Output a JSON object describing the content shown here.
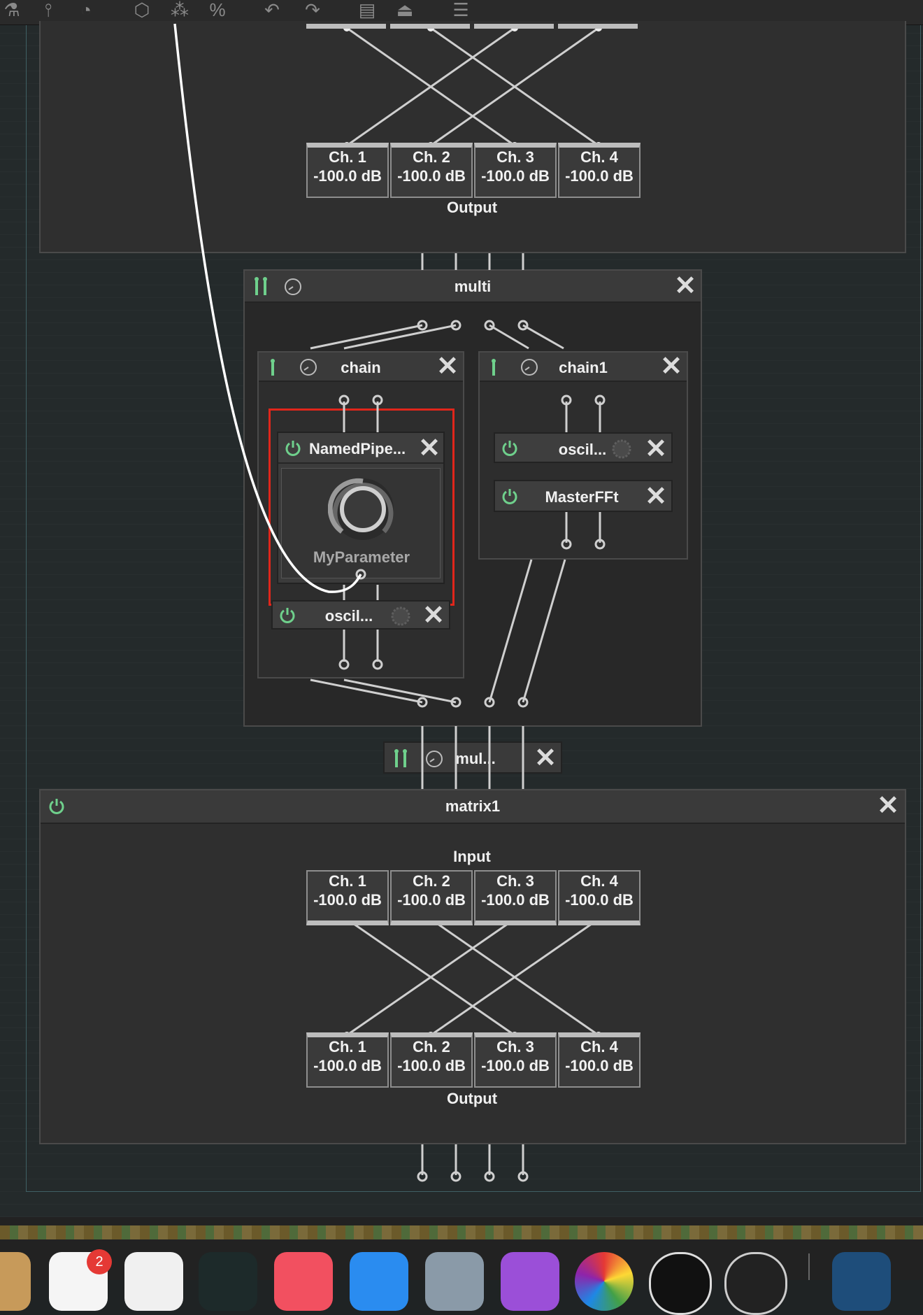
{
  "colors": {
    "accent_green": "#6fd08c",
    "highlight_red": "#e0261b",
    "cable_white": "#ffffff",
    "patch_grey": "#cfcfcf"
  },
  "toolbar": {
    "icons": [
      "flask-icon",
      "sliders-icon",
      "gauge-icon",
      "cube-icon",
      "circles-icon",
      "percent-icon",
      "undo-icon",
      "redo-icon",
      "save-icon",
      "eject-icon",
      "list-icon"
    ]
  },
  "top_matrix": {
    "outputs": [
      {
        "name": "Ch. 1",
        "level": "-100.0 dB"
      },
      {
        "name": "Ch. 2",
        "level": "-100.0 dB"
      },
      {
        "name": "Ch. 3",
        "level": "-100.0 dB"
      },
      {
        "name": "Ch. 4",
        "level": "-100.0 dB"
      }
    ],
    "output_label": "Output"
  },
  "multi": {
    "title": "multi",
    "chain": {
      "title": "chain",
      "named_pipe": {
        "title": "NamedPipe...",
        "knob_label": "MyParameter"
      },
      "oscil": {
        "title": "oscil..."
      }
    },
    "chain1": {
      "title": "chain1",
      "oscil": {
        "title": "oscil..."
      },
      "masterfft": {
        "title": "MasterFFt"
      }
    }
  },
  "mul_collapsed": {
    "title": "mul..."
  },
  "matrix1": {
    "title": "matrix1",
    "input_label": "Input",
    "inputs": [
      {
        "name": "Ch. 1",
        "level": "-100.0 dB"
      },
      {
        "name": "Ch. 2",
        "level": "-100.0 dB"
      },
      {
        "name": "Ch. 3",
        "level": "-100.0 dB"
      },
      {
        "name": "Ch. 4",
        "level": "-100.0 dB"
      }
    ],
    "outputs": [
      {
        "name": "Ch. 1",
        "level": "-100.0 dB"
      },
      {
        "name": "Ch. 2",
        "level": "-100.0 dB"
      },
      {
        "name": "Ch. 3",
        "level": "-100.0 dB"
      },
      {
        "name": "Ch. 4",
        "level": "-100.0 dB"
      }
    ],
    "output_label": "Output"
  },
  "dock": {
    "badge_count": "2",
    "apps": [
      "finder-icon",
      "reminders-icon",
      "preview-icon",
      "appletv-icon",
      "music-icon",
      "appstore-icon",
      "settings-icon",
      "podcasts-icon",
      "colorpicker-icon",
      "audiomixer-icon",
      "meter-icon",
      "window-icon"
    ]
  }
}
